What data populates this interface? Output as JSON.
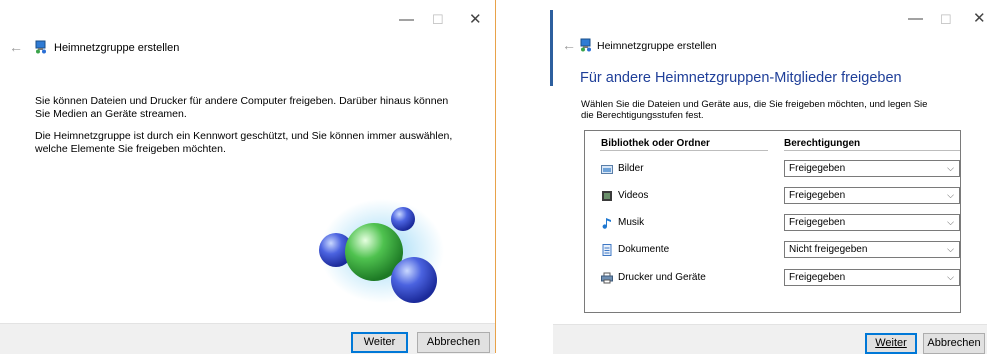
{
  "left_window": {
    "title": "Heimnetzgruppe erstellen",
    "paragraph1": "Sie können Dateien und Drucker für andere Computer freigeben. Darüber hinaus können Sie Medien an Geräte streamen.",
    "paragraph2": "Die Heimnetzgruppe ist durch ein Kennwort geschützt, und Sie können immer auswählen, welche Elemente Sie freigeben möchten.",
    "next_label": "Weiter",
    "cancel_label": "Abbrechen"
  },
  "right_window": {
    "title": "Heimnetzgruppe erstellen",
    "heading": "Für andere Heimnetzgruppen-Mitglieder freigeben",
    "instructions": "Wählen Sie die Dateien und Geräte aus, die Sie freigeben möchten, und legen Sie die Berechtigungsstufen fest.",
    "table": {
      "col_library": "Bibliothek oder Ordner",
      "col_permissions": "Berechtigungen",
      "rows": [
        {
          "label": "Bilder",
          "permission": "Freigegeben",
          "icon": "pictures-icon"
        },
        {
          "label": "Videos",
          "permission": "Freigegeben",
          "icon": "videos-icon"
        },
        {
          "label": "Musik",
          "permission": "Freigegeben",
          "icon": "music-icon"
        },
        {
          "label": "Dokumente",
          "permission": "Nicht freigegeben",
          "icon": "documents-icon"
        },
        {
          "label": "Drucker und Geräte",
          "permission": "Freigegeben",
          "icon": "printer-icon"
        }
      ]
    },
    "next_label": "Weiter",
    "cancel_label": "Abbrechen"
  },
  "controls": {
    "minimize": "—",
    "maximize": "☐",
    "close": "✕",
    "back": "←",
    "chevron": "⌵"
  },
  "colors": {
    "heading": "#1f3f99",
    "footer": "#f0f0f0",
    "accent": "#0078d7",
    "edge": "#e8a24a"
  }
}
